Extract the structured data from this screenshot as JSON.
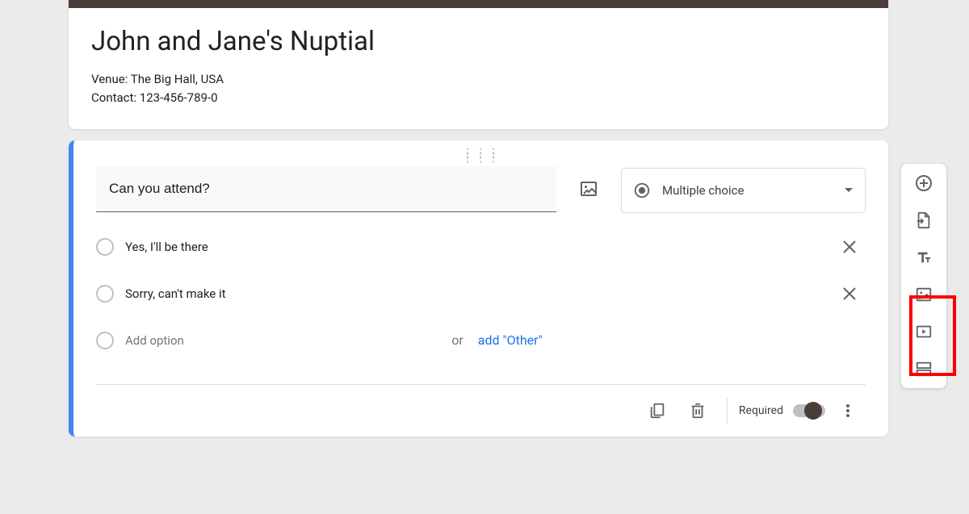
{
  "form": {
    "title": "John and Jane's Nuptial",
    "description_line1": "Venue: The Big Hall, USA",
    "description_line2": "Contact: 123-456-789-0"
  },
  "question": {
    "text": "Can you attend?",
    "type_label": "Multiple choice",
    "options": [
      "Yes,  I'll be there",
      "Sorry, can't make it"
    ],
    "add_option_placeholder": "Add option",
    "or_text": "or",
    "add_other_label": "add \"Other\""
  },
  "footer": {
    "required_label": "Required"
  }
}
